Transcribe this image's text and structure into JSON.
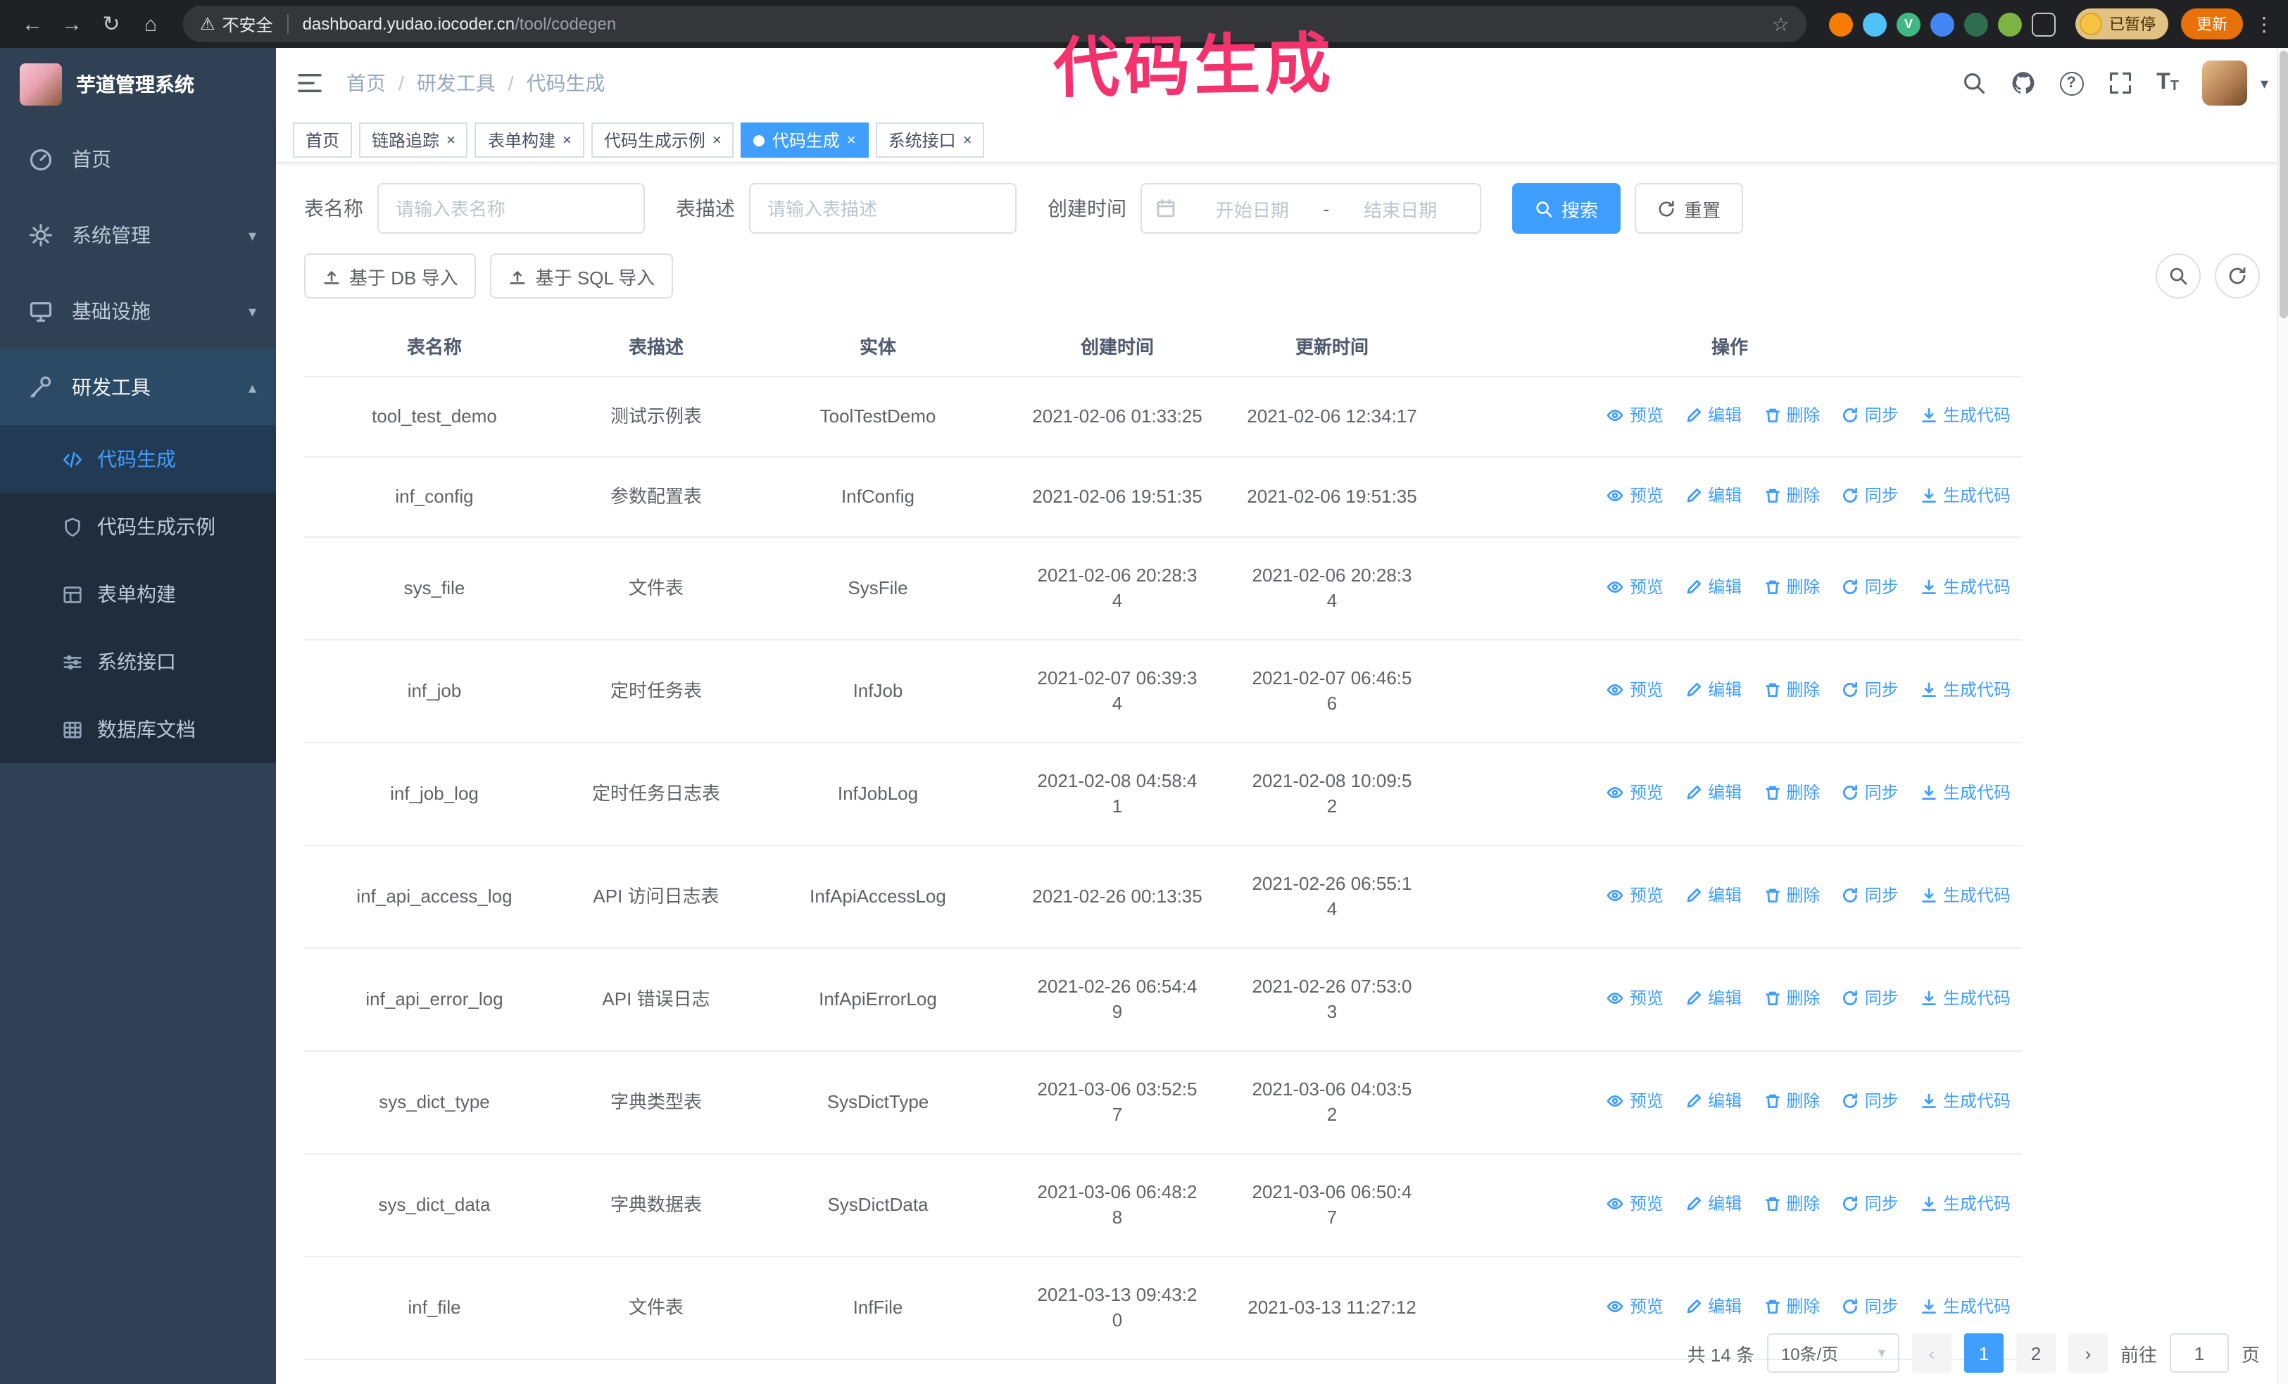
{
  "accent_color": "#409eff",
  "annotation": {
    "text": "代码生成",
    "color": "#f4336e"
  },
  "browser": {
    "security_label": "不安全",
    "url_host": "dashboard.yudao.iocoder.cn",
    "url_path": "/tool/codegen",
    "paused_badge": "已暂停",
    "update_button": "更新"
  },
  "icons": {
    "back": "←",
    "forward": "→",
    "reload": "↻",
    "home": "⌂",
    "warning": "⚠",
    "star": "☆",
    "more": "⋮",
    "question": "?",
    "caret_down": "▾",
    "chevron_down": "▾",
    "chevron_up": "▴",
    "close": "×",
    "prev": "‹",
    "next": "›",
    "vue_ext": "V",
    "text_large": "T",
    "text_small": "T"
  },
  "sidebar": {
    "app_title": "芋道管理系统",
    "items": {
      "home": "首页",
      "system": "系统管理",
      "infra": "基础设施",
      "devtools": "研发工具"
    },
    "submenu": {
      "codegen": "代码生成",
      "codegen_example": "代码生成示例",
      "form_builder": "表单构建",
      "system_api": "系统接口",
      "db_doc": "数据库文档"
    }
  },
  "breadcrumb": {
    "items": [
      "首页",
      "研发工具",
      "代码生成"
    ],
    "separator": "/"
  },
  "tabs": [
    {
      "label": "首页"
    },
    {
      "label": "链路追踪"
    },
    {
      "label": "表单构建"
    },
    {
      "label": "代码生成示例"
    },
    {
      "label": "代码生成"
    },
    {
      "label": "系统接口"
    }
  ],
  "filters": {
    "table_name_label": "表名称",
    "table_name_placeholder": "请输入表名称",
    "table_desc_label": "表描述",
    "table_desc_placeholder": "请输入表描述",
    "create_time_label": "创建时间",
    "date_start_placeholder": "开始日期",
    "date_separator": "-",
    "date_end_placeholder": "结束日期",
    "search_button": "搜索",
    "reset_button": "重置"
  },
  "toolbar": {
    "import_db": "基于 DB 导入",
    "import_sql": "基于 SQL 导入"
  },
  "table": {
    "headers": [
      "表名称",
      "表描述",
      "实体",
      "创建时间",
      "更新时间",
      "操作"
    ],
    "action_labels": {
      "preview": "预览",
      "edit": "编辑",
      "delete": "删除",
      "sync": "同步",
      "generate": "生成代码"
    },
    "rows": [
      {
        "name": "tool_test_demo",
        "desc": "测试示例表",
        "entity": "ToolTestDemo",
        "created": "2021-02-06 01:33:25",
        "updated": "2021-02-06 12:34:17"
      },
      {
        "name": "inf_config",
        "desc": "参数配置表",
        "entity": "InfConfig",
        "created": "2021-02-06 19:51:35",
        "updated": "2021-02-06 19:51:35"
      },
      {
        "name": "sys_file",
        "desc": "文件表",
        "entity": "SysFile",
        "created": "2021-02-06 20:28:3\n4",
        "updated": "2021-02-06 20:28:3\n4"
      },
      {
        "name": "inf_job",
        "desc": "定时任务表",
        "entity": "InfJob",
        "created": "2021-02-07 06:39:3\n4",
        "updated": "2021-02-07 06:46:5\n6"
      },
      {
        "name": "inf_job_log",
        "desc": "定时任务日志表",
        "entity": "InfJobLog",
        "created": "2021-02-08 04:58:4\n1",
        "updated": "2021-02-08 10:09:5\n2"
      },
      {
        "name": "inf_api_access_log",
        "desc": "API 访问日志表",
        "entity": "InfApiAccessLog",
        "created": "2021-02-26 00:13:35",
        "updated": "2021-02-26 06:55:1\n4"
      },
      {
        "name": "inf_api_error_log",
        "desc": "API 错误日志",
        "entity": "InfApiErrorLog",
        "created": "2021-02-26 06:54:4\n9",
        "updated": "2021-02-26 07:53:0\n3"
      },
      {
        "name": "sys_dict_type",
        "desc": "字典类型表",
        "entity": "SysDictType",
        "created": "2021-03-06 03:52:5\n7",
        "updated": "2021-03-06 04:03:5\n2"
      },
      {
        "name": "sys_dict_data",
        "desc": "字典数据表",
        "entity": "SysDictData",
        "created": "2021-03-06 06:48:2\n8",
        "updated": "2021-03-06 06:50:4\n7"
      },
      {
        "name": "inf_file",
        "desc": "文件表",
        "entity": "InfFile",
        "created": "2021-03-13 09:43:2\n0",
        "updated": "2021-03-13 11:27:12"
      }
    ]
  },
  "pagination": {
    "total_text": "共 14 条",
    "page_size": "10条/页",
    "page_1": "1",
    "page_2": "2",
    "goto_label": "前往",
    "goto_value": "1",
    "goto_suffix": "页"
  }
}
